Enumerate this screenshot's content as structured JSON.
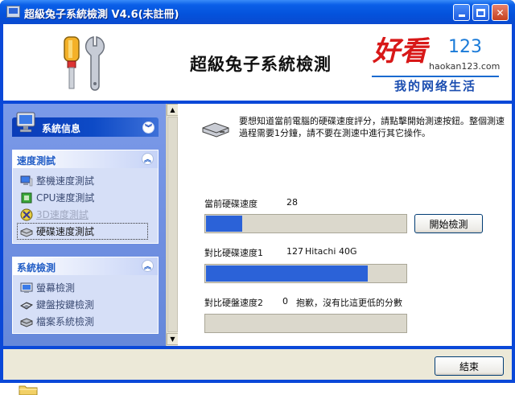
{
  "window": {
    "title": "超級兔子系統檢測 V4.6(未註冊)",
    "accent": "#0a48d8"
  },
  "header": {
    "title": "超級兔子系統檢測",
    "logo": {
      "brand": "好看",
      "number": "123",
      "url": "haokan123.com",
      "slogan": "我的网络生活"
    }
  },
  "sidebar": {
    "system_info": {
      "label": "系統信息",
      "icon": "monitor-icon"
    },
    "speed_panel": {
      "title": "速度測試",
      "items": [
        {
          "label": "整機速度測試",
          "icon": "pc-icon",
          "state": "normal"
        },
        {
          "label": "CPU速度測試",
          "icon": "cpu-icon",
          "state": "normal"
        },
        {
          "label": "3D速度測試",
          "icon": "3d-icon",
          "state": "disabled"
        },
        {
          "label": "硬碟速度測試",
          "icon": "hdd-icon",
          "state": "selected"
        }
      ]
    },
    "system_panel": {
      "title": "系統檢測",
      "items": [
        {
          "label": "螢幕檢測",
          "icon": "monitor-test-icon"
        },
        {
          "label": "鍵盤按鍵檢測",
          "icon": "keyboard-icon"
        },
        {
          "label": "檔案系統檢測",
          "icon": "file-system-icon"
        }
      ]
    }
  },
  "main": {
    "intro": "要想知道當前電腦的硬碟速度評分，請點擊開始測速按鈕。整個測速過程需要1分鐘，請不要在測速中進行其它操作。",
    "current": {
      "label": "當前硬碟速度",
      "value": "28",
      "fill": 0.18
    },
    "compare1": {
      "label": "對比硬碟速度1",
      "value": "127",
      "model": "Hitachi 40G",
      "fill": 0.81
    },
    "compare2": {
      "label": "對比硬盤速度2",
      "value": "0",
      "note": "抱歉，沒有比這更低的分數",
      "fill": 0
    },
    "start_button": "開始檢測"
  },
  "footer": {
    "close_button": "結束"
  }
}
